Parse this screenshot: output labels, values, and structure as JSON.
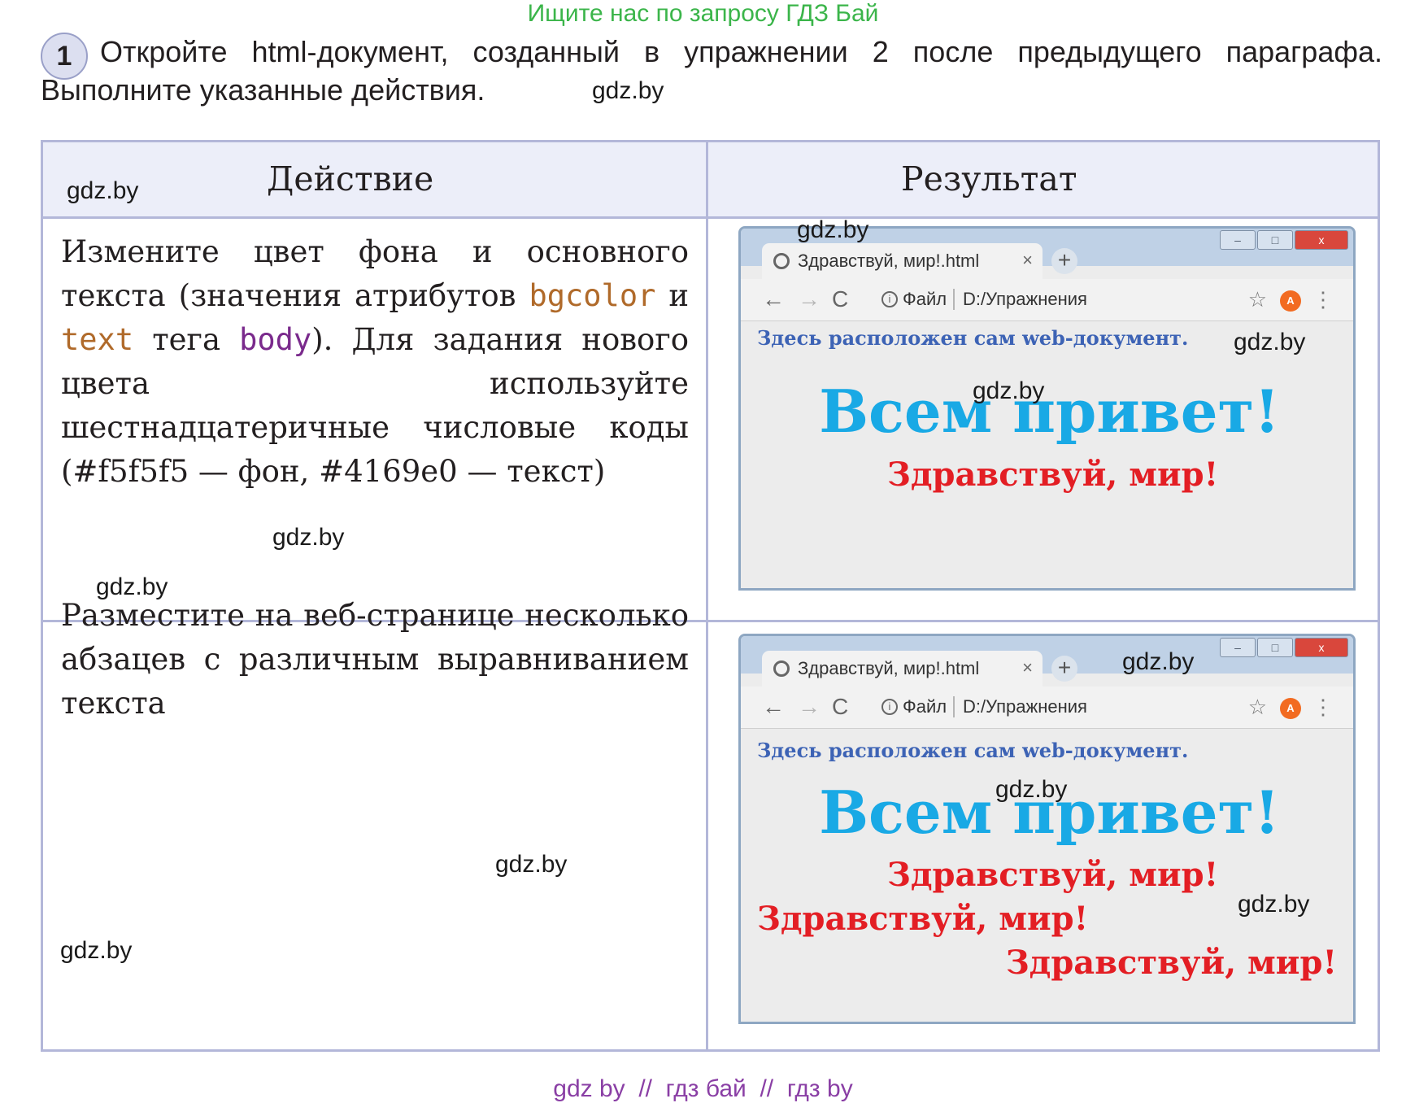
{
  "banner": "Ищите нас по запросу ГДЗ Бай",
  "task": {
    "number": "1",
    "text": "Откройте html-документ, созданный в упражнении 2 после предыдущего параграфа. Выполните указанные действия."
  },
  "watermark": "gdz.by",
  "table": {
    "headers": [
      "Действие",
      "Результат"
    ],
    "row1": {
      "a": "Измените цвет фона и основного текста (значения атрибутов",
      "attr1": "bgcolor",
      "and": "и",
      "attr2": "text",
      "tag_word": "тега",
      "tag": "body",
      "b": "). Для задания нового цвета используйте шестнадцатеричные числовые коды (#f5f5f5 — фон, #4169e0 — текст)"
    },
    "row2": {
      "text": "Разместите на веб-странице несколько абзацев с различным выравниванием текста"
    }
  },
  "browser": {
    "tab_title": "Здравствуй, мир!.html",
    "tab_close": "×",
    "new_tab": "+",
    "back": "←",
    "forward": "→",
    "reload": "C",
    "info": "i",
    "scheme": "Файл",
    "path": "D:/Упражнения",
    "star": "☆",
    "menu": "⋮",
    "win_min": "–",
    "win_max": "□",
    "win_close": "x",
    "doc_line": "Здесь расположен сам web-документ.",
    "greeting": "Всем привет!",
    "hello": "Здравствуй, мир!"
  },
  "footer": "gdz by  //  гдз бай  //  гдз by",
  "colors": {
    "banner": "#3bb54a",
    "footer": "#8a3fa5",
    "table_border": "#b3b7d9",
    "header_bg": "#eceef9",
    "attr_color": "#b06a2a",
    "tag_color": "#7a2a8c",
    "doc_text": "#3d63b5",
    "greeting": "#19a9e5",
    "hello": "#e31e24"
  },
  "icons": [
    "circle-icon",
    "back-arrow-icon",
    "forward-arrow-icon",
    "reload-icon",
    "info-icon",
    "star-icon",
    "extension-icon",
    "kebab-menu-icon",
    "close-icon",
    "plus-icon"
  ]
}
